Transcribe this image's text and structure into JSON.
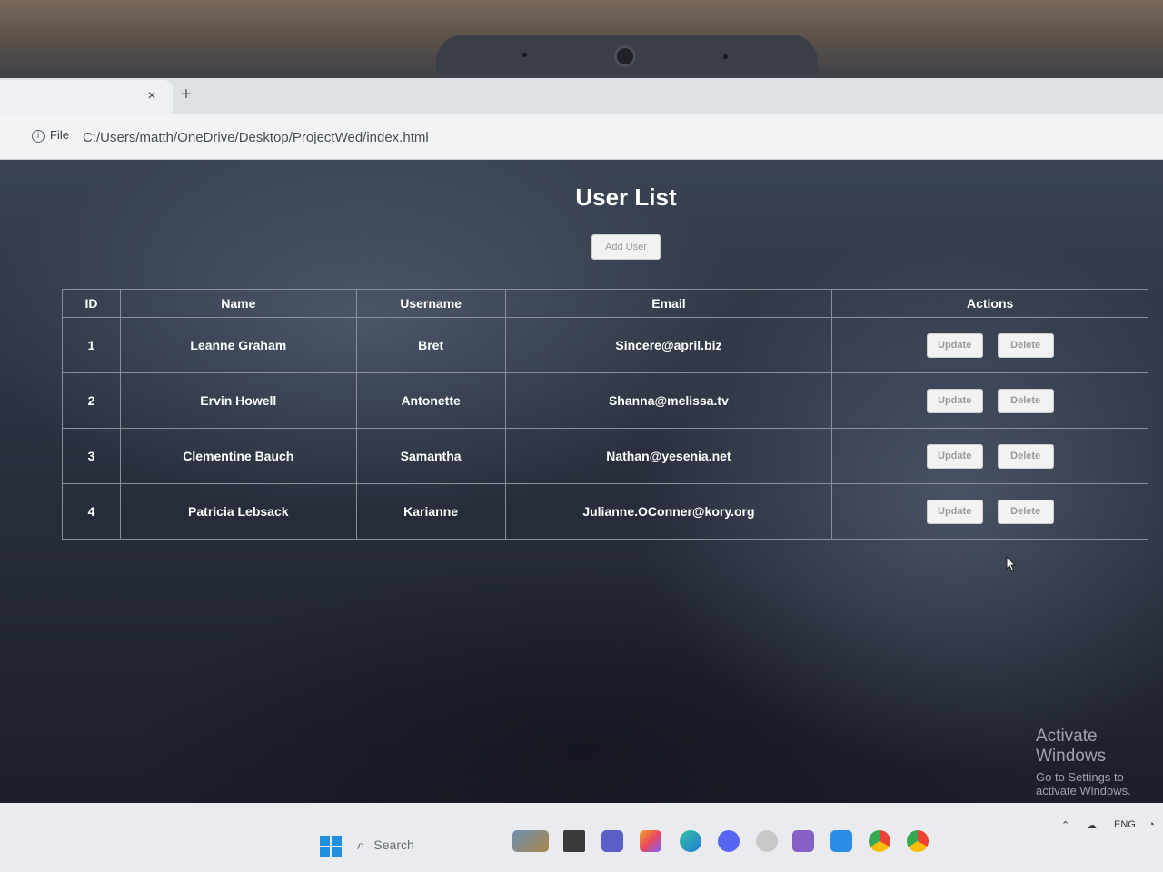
{
  "browser": {
    "tab_close": "×",
    "new_tab": "+",
    "address_chip": "File",
    "url": "C:/Users/matth/OneDrive/Desktop/ProjectWed/index.html"
  },
  "page": {
    "title": "User List",
    "add_button": "Add User"
  },
  "table": {
    "headers": [
      "ID",
      "Name",
      "Username",
      "Email",
      "Actions"
    ],
    "rows": [
      {
        "id": "1",
        "name": "Leanne Graham",
        "username": "Bret",
        "email": "Sincere@april.biz"
      },
      {
        "id": "2",
        "name": "Ervin Howell",
        "username": "Antonette",
        "email": "Shanna@melissa.tv"
      },
      {
        "id": "3",
        "name": "Clementine Bauch",
        "username": "Samantha",
        "email": "Nathan@yesenia.net"
      },
      {
        "id": "4",
        "name": "Patricia Lebsack",
        "username": "Karianne",
        "email": "Julianne.OConner@kory.org"
      }
    ],
    "update_label": "Update",
    "delete_label": "Delete"
  },
  "watermark": {
    "line1": "Activate Windows",
    "line2": "Go to Settings to activate Windows."
  },
  "taskbar": {
    "search_placeholder": "Search",
    "language": "ENG",
    "icons": [
      "windows-start-icon",
      "search-icon",
      "file-explorer-icon",
      "teams-icon",
      "copilot-icon",
      "edge-icon",
      "discord-icon",
      "chatgpt-icon",
      "visual-studio-icon",
      "vscode-icon",
      "chrome-icon",
      "chrome-profile-icon"
    ]
  }
}
